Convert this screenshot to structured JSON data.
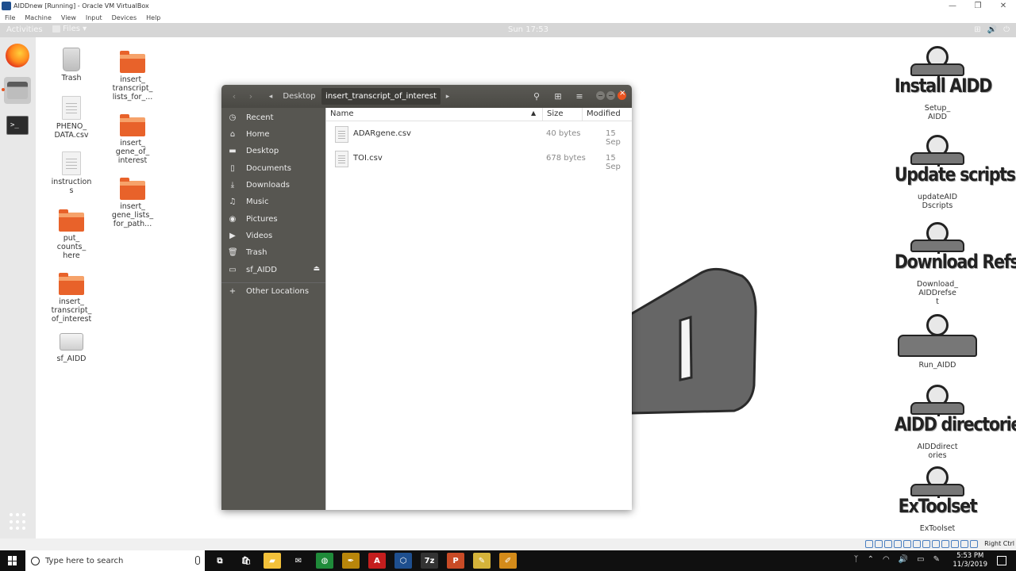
{
  "host_window": {
    "title": "AIDDnew [Running] - Oracle VM VirtualBox",
    "menu": [
      "File",
      "Machine",
      "View",
      "Input",
      "Devices",
      "Help"
    ],
    "controls": [
      "—",
      "❐",
      "✕"
    ]
  },
  "topbar": {
    "activities": "Activities",
    "app_menu": "Files ▾",
    "clock": "Sun 17:53",
    "system_icons": [
      "⊞",
      "🔊",
      "⏻"
    ]
  },
  "dock": {
    "items": [
      "firefox-icon",
      "files-icon",
      "terminal-icon"
    ],
    "terminal_glyph": ">_"
  },
  "desktop": {
    "icons": [
      {
        "label": "Trash",
        "icon": "trash-icon"
      },
      {
        "label": "PHENO_\nDATA.csv",
        "icon": "document-icon"
      },
      {
        "label": "instruction\ns",
        "icon": "document-icon"
      },
      {
        "label": "put_\ncounts_\nhere",
        "icon": "folder-icon"
      },
      {
        "label": "insert_\ntranscript_\nof_interest",
        "icon": "folder-icon"
      },
      {
        "label": "sf_AIDD",
        "icon": "drive-icon"
      },
      {
        "label": "insert_\ntranscript_\nlists_for_...",
        "icon": "folder-icon"
      },
      {
        "label": "insert_\ngene_of_\ninterest",
        "icon": "folder-icon"
      },
      {
        "label": "insert_\ngene_lists_\nfor_path...",
        "icon": "folder-icon"
      }
    ],
    "aidd_launchers": [
      {
        "big_text": "Install AIDD",
        "caption": "Setup_\nAIDD"
      },
      {
        "big_text": "Update scripts",
        "caption": "updateAID\nDscripts"
      },
      {
        "big_text": "Download Refset",
        "caption": "Download_\nAIDDrefse\nt"
      },
      {
        "big_text": "",
        "caption": "Run_AIDD"
      },
      {
        "big_text": "AIDD directories",
        "caption": "AIDDdirect\nories"
      },
      {
        "big_text": "ExToolset",
        "caption": "ExToolset"
      }
    ]
  },
  "files_window": {
    "path": {
      "parent": "Desktop",
      "current": "insert_transcript_of_interest"
    },
    "sidebar": [
      {
        "label": "Recent",
        "icon": "clock-icon",
        "glyph": "◷"
      },
      {
        "label": "Home",
        "icon": "home-icon",
        "glyph": "⌂"
      },
      {
        "label": "Desktop",
        "icon": "folder-icon",
        "glyph": "▬"
      },
      {
        "label": "Documents",
        "icon": "document-icon",
        "glyph": "▯"
      },
      {
        "label": "Downloads",
        "icon": "download-icon",
        "glyph": "⤓"
      },
      {
        "label": "Music",
        "icon": "music-icon",
        "glyph": "♫"
      },
      {
        "label": "Pictures",
        "icon": "camera-icon",
        "glyph": "◉"
      },
      {
        "label": "Videos",
        "icon": "video-icon",
        "glyph": "▶"
      },
      {
        "label": "Trash",
        "icon": "trash-icon",
        "glyph": "🗑"
      },
      {
        "label": "sf_AIDD",
        "icon": "drive-icon",
        "glyph": "▭"
      }
    ],
    "other_locations": {
      "label": "Other Locations",
      "glyph": "+"
    },
    "eject_glyph": "⏏",
    "columns": {
      "name": "Name",
      "size": "Size",
      "modified": "Modified",
      "sort_glyph": "▲"
    },
    "files": [
      {
        "name": "ADARgene.csv",
        "size": "40 bytes",
        "modified": "15 Sep"
      },
      {
        "name": "TOI.csv",
        "size": "678 bytes",
        "modified": "15 Sep"
      }
    ],
    "header_glyphs": {
      "back": "‹",
      "forward": "›",
      "path_left": "◂",
      "path_right": "▸",
      "search": "⚲",
      "view": "⊞",
      "menu": "≡"
    }
  },
  "host_status": {
    "label": "Right Ctrl"
  },
  "taskbar": {
    "search_placeholder": "Type here to search",
    "time": "5:53 PM",
    "date": "11/3/2019",
    "tray": [
      "ᛉ",
      "⌃",
      "◠",
      "🔊",
      "▭",
      "✎"
    ],
    "apps": [
      {
        "name": "task-view-icon",
        "glyph": "⧉",
        "color": "#101010"
      },
      {
        "name": "store-icon",
        "glyph": "🛍",
        "color": "#101010"
      },
      {
        "name": "file-explorer-icon",
        "glyph": "▰",
        "color": "#f3c13a"
      },
      {
        "name": "mail-icon",
        "glyph": "✉",
        "color": "#101010"
      },
      {
        "name": "chrome-icon",
        "glyph": "◍",
        "color": "#1f8b3a"
      },
      {
        "name": "pen-icon",
        "glyph": "✒",
        "color": "#b8860b"
      },
      {
        "name": "acrobat-icon",
        "glyph": "A",
        "color": "#c41e1e"
      },
      {
        "name": "virtualbox-icon",
        "glyph": "⬡",
        "color": "#1e4f8f"
      },
      {
        "name": "7zip-icon",
        "glyph": "7z",
        "color": "#333333"
      },
      {
        "name": "powerpoint-icon",
        "glyph": "P",
        "color": "#c94b26"
      },
      {
        "name": "paint-icon",
        "glyph": "✎",
        "color": "#d5b33a"
      },
      {
        "name": "sketch-icon",
        "glyph": "✐",
        "color": "#d48b1a"
      }
    ]
  }
}
